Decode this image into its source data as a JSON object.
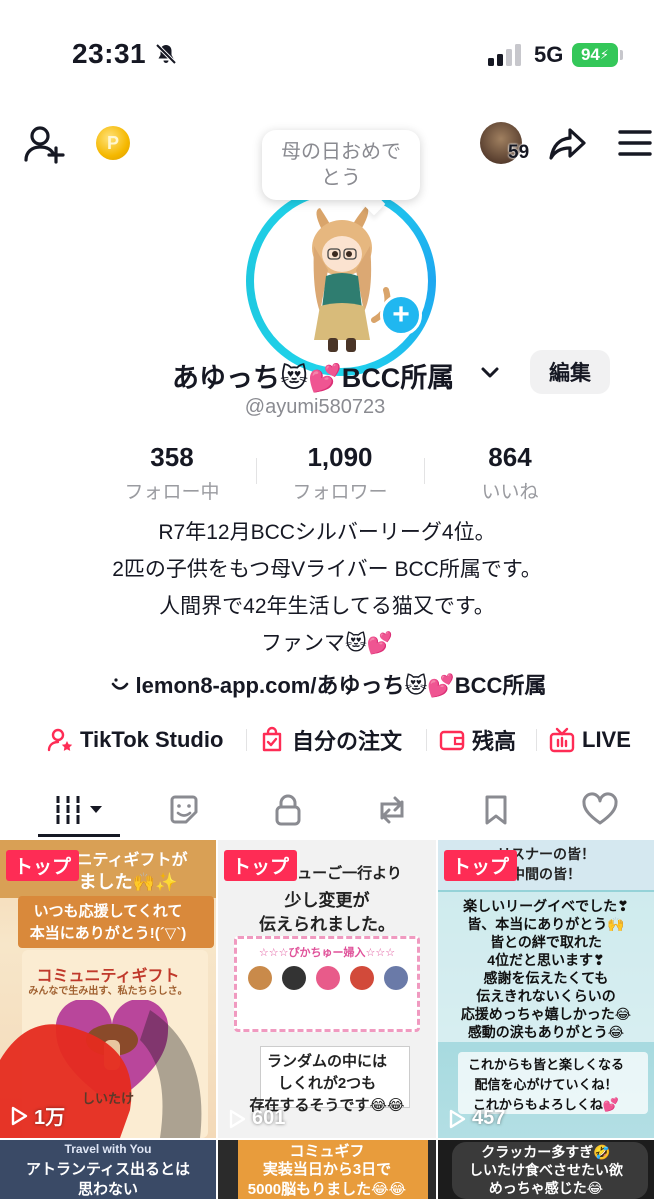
{
  "status_bar": {
    "time": "23:31",
    "network": "5G",
    "battery": "94"
  },
  "header": {
    "friend_count": "59",
    "coin_symbol": "P",
    "bubble_line1": "母の日おめで",
    "bubble_line2": "とう"
  },
  "profile": {
    "name": "あゆっち😻💕BCC所属",
    "edit_label": "編集",
    "handle": "@ayumi580723",
    "avatar_plus": "+"
  },
  "stats": [
    {
      "value": "358",
      "label": "フォロー中"
    },
    {
      "value": "1,090",
      "label": "フォロワー"
    },
    {
      "value": "864",
      "label": "いいね"
    }
  ],
  "bio": [
    "R7年12月BCCシルバーリーグ4位。",
    "2匹の子供をもつ母Vライバー BCC所属です。",
    "人間界で42年生活してる猫又です。",
    "ファンマ😻💕"
  ],
  "link": "lemon8-app.com/あゆっち😻💕BCC所属",
  "shortcuts": [
    {
      "label": "TikTok Studio",
      "icon": "studio-icon"
    },
    {
      "label": "自分の注文",
      "icon": "orders-icon"
    },
    {
      "label": "残高",
      "icon": "wallet-icon"
    },
    {
      "label": "LIVE",
      "icon": "live-icon"
    }
  ],
  "tabs": [
    "videos-tab",
    "stickers-tab",
    "private-tab",
    "reposts-tab",
    "favorites-tab",
    "liked-tab"
  ],
  "videos": [
    {
      "pinned": "トップ",
      "views": "1万",
      "lines": [
        "コミュニティギフトが",
        "ました🙌✨",
        "いつも応援してくれて",
        "本当にありがとう!(´▽`)",
        "コミュニティギフト",
        "みんなで生み出す、私たちらしさ。",
        "しいたけ"
      ]
    },
    {
      "pinned": "トップ",
      "views": "601",
      "lines": [
        "ヒカチューご一行より",
        "少し変更が",
        "伝えられました。",
        "☆☆☆ぴかちゅー婦入☆☆☆",
        "ランダムの中には",
        "しくれが2つも",
        "存在するそうです😂😂"
      ]
    },
    {
      "pinned": "トップ",
      "views": "457",
      "lines": [
        "リスナーの皆！",
        "中間の皆！",
        "楽しいリーグイベでした❣",
        "皆、本当にありがとう🙌",
        "皆との絆で取れた",
        "4位だと思います❣",
        "感謝を伝えたくても",
        "伝えきれないくらいの",
        "応援めっちゃ嬉しかった😂",
        "感動の涙もありがとう😂",
        "これからも皆と楽しくなる",
        "配信を心がけていくね！",
        "これからもよろしくね💕"
      ]
    },
    {
      "lines": [
        "Travel with You",
        "アトランティス出るとは",
        "思わない"
      ]
    },
    {
      "lines": [
        "コミュギフ",
        "実装当日から3日で",
        "5000脳もりました😂😂"
      ]
    },
    {
      "lines": [
        "クラッカー多すぎ🤣",
        "しいたけ食べさせたい欲",
        "めっちゃ感じた😂"
      ]
    }
  ],
  "colors": {
    "accent": "#fe2c55",
    "ring": "#20d5ec",
    "battery": "#34c759"
  }
}
